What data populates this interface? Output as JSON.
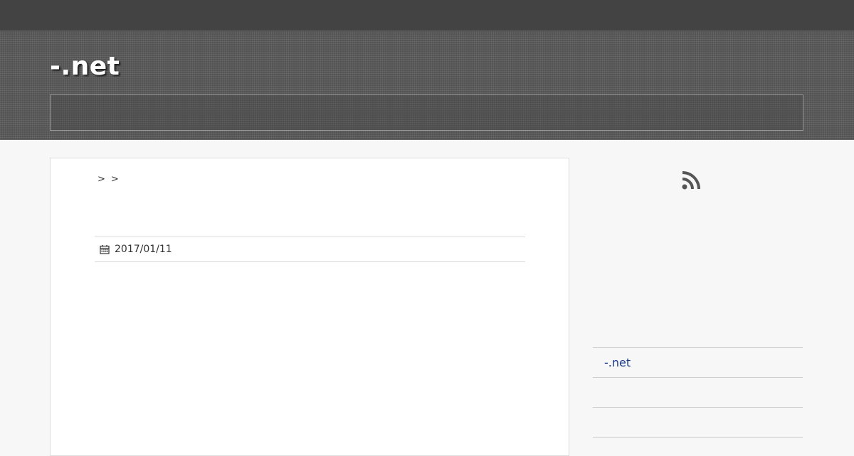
{
  "site": {
    "title": "-.net"
  },
  "breadcrumb": {
    "separators": [
      ">",
      ">"
    ]
  },
  "post": {
    "date": "2017/01/11"
  },
  "icons": {
    "date": "calendar-icon",
    "feed": "rss-icon"
  },
  "sidebar": {
    "links": [
      "-.net",
      "",
      ""
    ]
  },
  "colors": {
    "topbar": "#434343",
    "header": "#5c5c5c",
    "link": "#1a3a8f",
    "page_bg": "#f7f7f7"
  }
}
